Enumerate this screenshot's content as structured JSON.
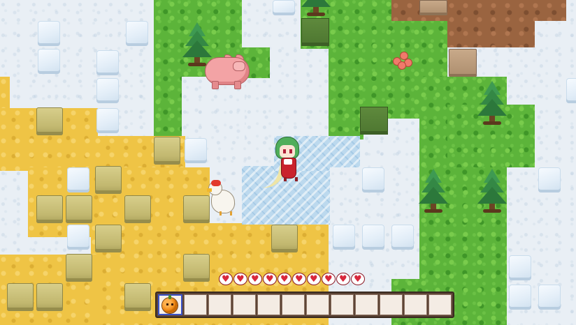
{
  "game": {
    "hud": {
      "hearts": [
        "♥",
        "♥",
        "♥",
        "♥",
        "♥",
        "♥",
        "♥",
        "♥",
        "♥",
        "♥"
      ],
      "hotbar": {
        "slot_count": 12,
        "selected_index": 0,
        "selected_item_icon": "pumpkin-icon"
      }
    },
    "entities": [
      {
        "type": "player",
        "name_icon": "green-haired-girl"
      },
      {
        "type": "pig"
      },
      {
        "type": "chicken"
      },
      {
        "type": "flower"
      }
    ],
    "terrain_colors": {
      "snow": "#e9eff5",
      "grass": "#5cb43a",
      "sand": "#efc445",
      "dirt": "#9a6440",
      "water": "#bcd9ee"
    }
  }
}
